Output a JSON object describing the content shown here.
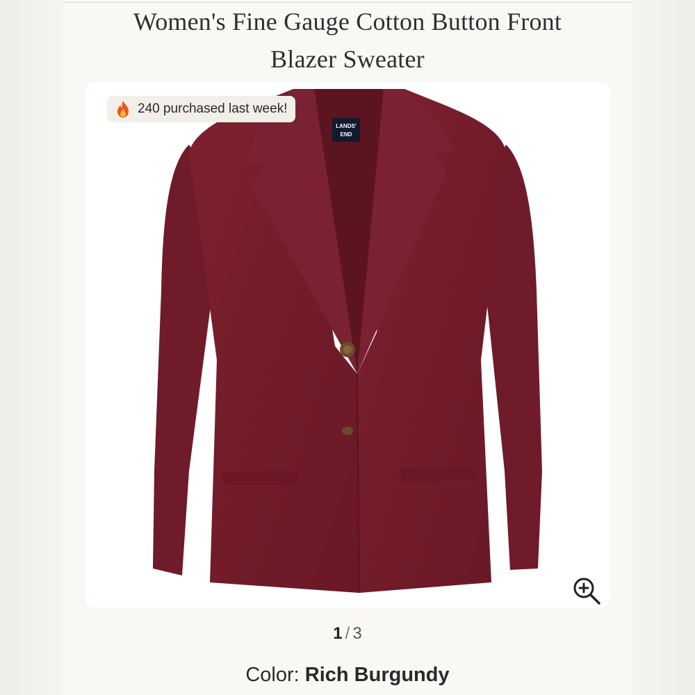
{
  "product": {
    "title_line1": "Women's Fine Gauge Cotton Button Front",
    "title_line2": "Blazer Sweater"
  },
  "gallery": {
    "badge_text": "240 purchased last week!",
    "badge_icon": "fire-icon",
    "brand_tag": "LANDS' END",
    "current_page": "1",
    "separator": "/",
    "total_pages": "3",
    "zoom_icon": "zoom-in-icon"
  },
  "color": {
    "label": "Color:",
    "value": "Rich Burgundy",
    "swatch_hex": "#7a1f2b"
  }
}
